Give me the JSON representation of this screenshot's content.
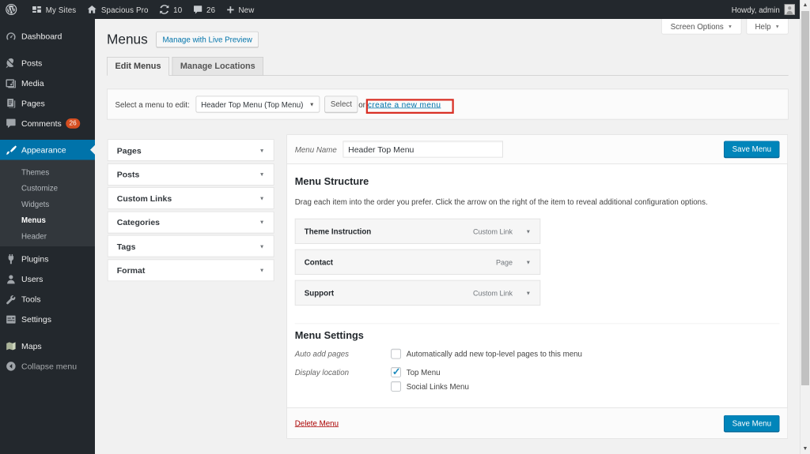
{
  "colors": {
    "adminbar_bg": "#23282d",
    "sidebar_bg": "#23282d",
    "submenu_bg": "#32373c",
    "current_item_bg": "#0073aa",
    "badge_bg": "#d54e21",
    "page_bg": "#f1f1f1",
    "primary_button_bg": "#0085ba",
    "link_blue": "#0073aa",
    "annotation_red": "#d93025",
    "delete_red": "#a00"
  },
  "admin_bar": {
    "my_sites": "My Sites",
    "site_name": "Spacious Pro",
    "updates_count": "10",
    "comments_count": "26",
    "new_label": "New",
    "howdy": "Howdy, admin"
  },
  "sidebar": {
    "items": [
      {
        "label": "Dashboard"
      },
      {
        "label": "Posts"
      },
      {
        "label": "Media"
      },
      {
        "label": "Pages"
      },
      {
        "label": "Comments",
        "badge": "26"
      },
      {
        "label": "Appearance"
      },
      {
        "label": "Plugins"
      },
      {
        "label": "Users"
      },
      {
        "label": "Tools"
      },
      {
        "label": "Settings"
      },
      {
        "label": "Maps"
      },
      {
        "label": "Collapse menu"
      }
    ],
    "appearance_submenu": [
      {
        "label": "Themes"
      },
      {
        "label": "Customize"
      },
      {
        "label": "Widgets"
      },
      {
        "label": "Menus",
        "current": true
      },
      {
        "label": "Header"
      }
    ]
  },
  "page": {
    "title": "Menus",
    "title_action": "Manage with Live Preview",
    "screen_options": "Screen Options",
    "help": "Help",
    "tabs": [
      {
        "label": "Edit Menus",
        "active": true
      },
      {
        "label": "Manage Locations",
        "active": false
      }
    ],
    "manage_bar": {
      "label": "Select a menu to edit:",
      "select_value": "Header Top Menu (Top Menu)",
      "select_button": "Select",
      "or_text": "or",
      "create_link": "create a new menu"
    },
    "accordion": [
      {
        "label": "Pages"
      },
      {
        "label": "Posts"
      },
      {
        "label": "Custom Links"
      },
      {
        "label": "Categories"
      },
      {
        "label": "Tags"
      },
      {
        "label": "Format"
      }
    ],
    "editor": {
      "menu_name_label": "Menu Name",
      "menu_name_value": "Header Top Menu",
      "save_button": "Save Menu",
      "structure_heading": "Menu Structure",
      "structure_help": "Drag each item into the order you prefer. Click the arrow on the right of the item to reveal additional configuration options.",
      "items": [
        {
          "title": "Theme Instruction",
          "type": "Custom Link"
        },
        {
          "title": "Contact",
          "type": "Page"
        },
        {
          "title": "Support",
          "type": "Custom Link"
        }
      ],
      "settings_heading": "Menu Settings",
      "auto_add_label": "Auto add pages",
      "auto_add_option": "Automatically add new top-level pages to this menu",
      "display_location_label": "Display location",
      "locations": [
        {
          "label": "Top Menu",
          "checked": true
        },
        {
          "label": "Social Links Menu",
          "checked": false
        }
      ],
      "delete_link": "Delete Menu"
    }
  }
}
